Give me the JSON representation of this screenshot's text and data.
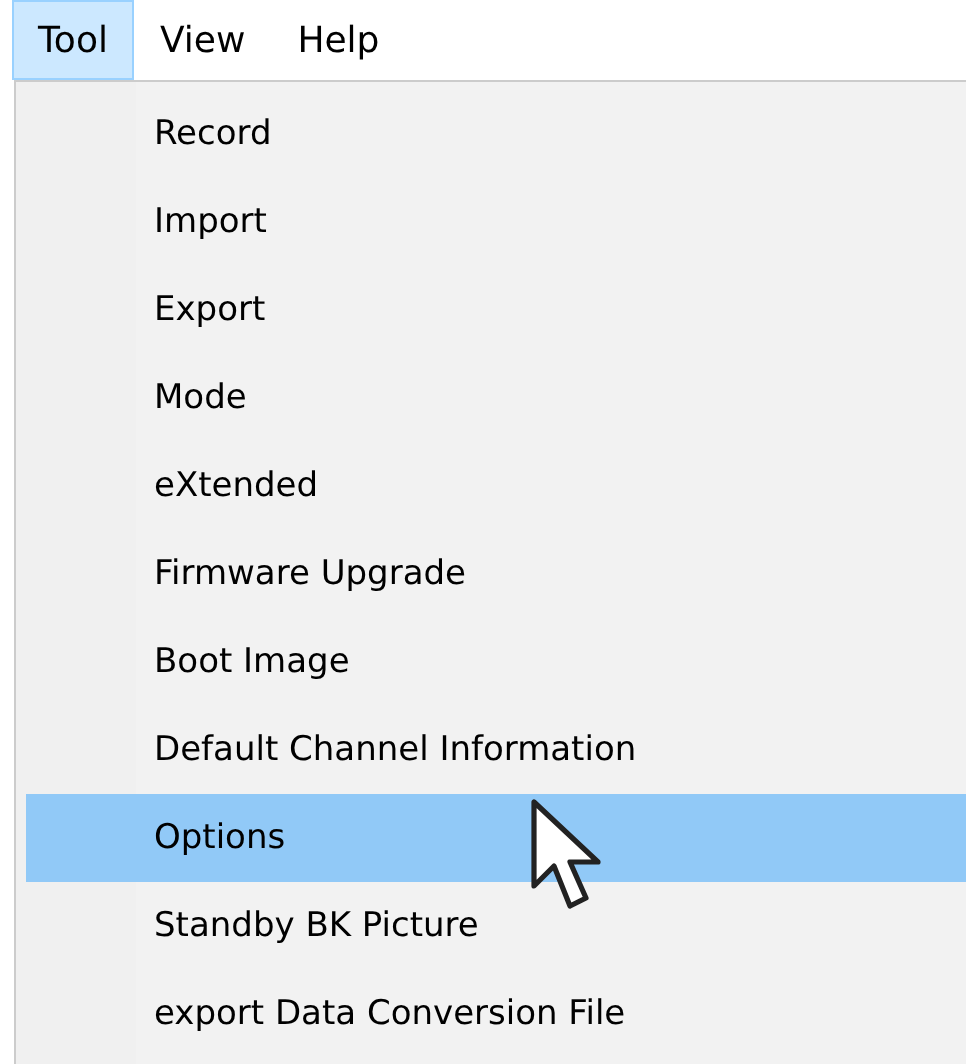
{
  "menu_bar": [
    {
      "label": "Tool",
      "selected": true
    },
    {
      "label": "View",
      "selected": false
    },
    {
      "label": "Help",
      "selected": false
    }
  ],
  "menu": {
    "items": [
      {
        "label": "Record",
        "selected": false
      },
      {
        "label": "Import",
        "selected": false
      },
      {
        "label": "Export",
        "selected": false
      },
      {
        "label": "Mode",
        "selected": false
      },
      {
        "label": "eXtended",
        "selected": false
      },
      {
        "label": "Firmware Upgrade",
        "selected": false
      },
      {
        "label": "Boot Image",
        "selected": false
      },
      {
        "label": "Default Channel Information",
        "selected": false
      },
      {
        "label": "Options",
        "selected": true
      },
      {
        "label": "Standby BK Picture",
        "selected": false
      },
      {
        "label": "export Data Conversion File",
        "selected": false
      }
    ]
  }
}
